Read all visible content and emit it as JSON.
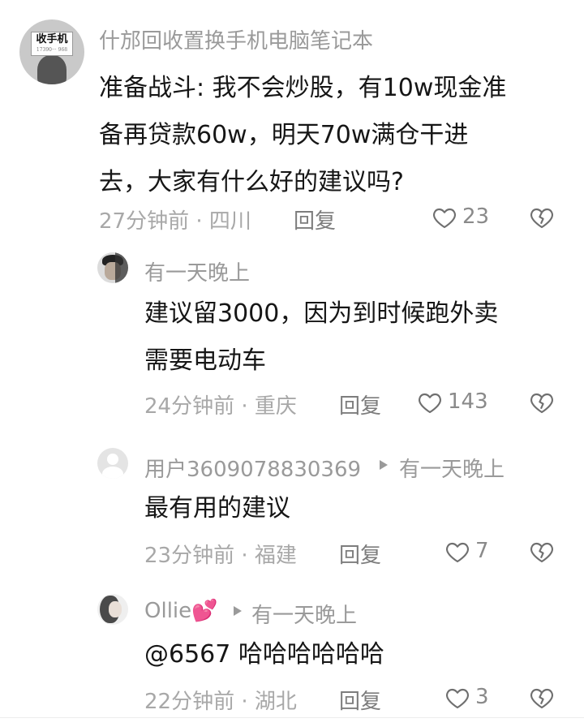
{
  "comments": [
    {
      "username": "什邡回收置换手机电脑笔记本",
      "avatar_sign": "收手机",
      "avatar_sign_small": "17390··· 968",
      "text_lines": [
        "准备战斗: 我不会炒股，有10w现金准",
        "备再贷款60w，明天70w满仓干进",
        "去，大家有什么好的建议吗?"
      ],
      "time_location": "27分钟前 · 四川",
      "reply_label": "回复",
      "likes": "23"
    },
    {
      "username": "有一天晚上",
      "text_lines": [
        "建议留3000，因为到时候跑外卖",
        "需要电动车"
      ],
      "time_location": "24分钟前 · 重庆",
      "reply_label": "回复",
      "likes": "143"
    },
    {
      "username": "用户3609078830369",
      "reply_to": "有一天晚上",
      "text_lines": [
        "最有用的建议"
      ],
      "time_location": "23分钟前 · 福建",
      "reply_label": "回复",
      "likes": "7"
    },
    {
      "username": "Ollie",
      "username_emoji": "💕",
      "reply_to": "有一天晚上",
      "text_lines": [
        "@6567 哈哈哈哈哈哈"
      ],
      "time_location": "22分钟前 · 湖北",
      "reply_label": "回复",
      "likes": "3"
    }
  ],
  "icons": {
    "like": "heart-outline-icon",
    "dislike": "broken-heart-icon",
    "reply_arrow": "triangle-right-icon"
  },
  "colors": {
    "text": "#161616",
    "meta": "#a8a8a8",
    "username": "#9a9a9a"
  }
}
